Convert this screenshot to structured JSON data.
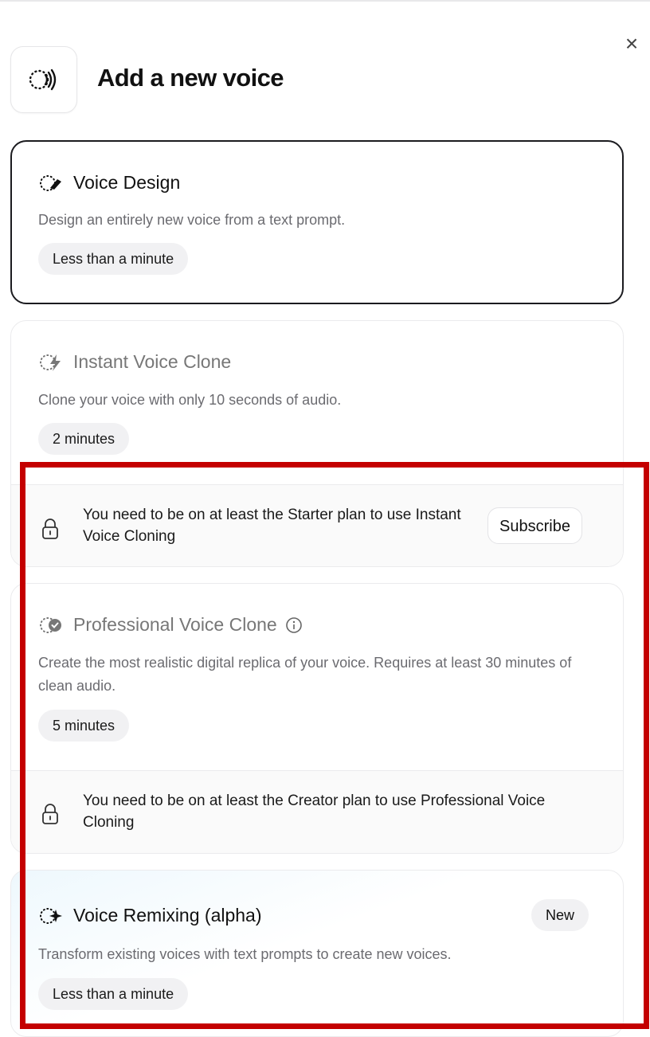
{
  "dialog": {
    "title": "Add a new voice",
    "close_glyph": "×",
    "header_icon": "voice-waves-icon"
  },
  "options": [
    {
      "title": "Voice Design",
      "icon": "voice-design-icon",
      "description": "Design an entirely new voice from a text prompt.",
      "duration": "Less than a minute",
      "selected": true
    },
    {
      "title": "Instant Voice Clone",
      "icon": "instant-clone-icon",
      "description": "Clone your voice with only 10 seconds of audio.",
      "duration": "2 minutes",
      "locked_message": "You need to be on at least the Starter plan to use Instant Voice Cloning",
      "action_label": "Subscribe"
    },
    {
      "title": "Professional Voice Clone",
      "icon": "professional-clone-icon",
      "info_icon": "info-icon",
      "description": "Create the most realistic digital replica of your voice. Requires at least 30 minutes of clean audio.",
      "duration": "5 minutes",
      "locked_message": "You need to be on at least the Creator plan to use Professional Voice Cloning"
    },
    {
      "title": "Voice Remixing (alpha)",
      "icon": "voice-remix-icon",
      "badge": "New",
      "description": "Transform existing voices with text prompts to create new voices.",
      "duration": "Less than a minute"
    }
  ],
  "colors": {
    "annotation_border": "#c40000",
    "selected_border": "#1b1b1f",
    "pill_bg": "#f1f1f3"
  }
}
